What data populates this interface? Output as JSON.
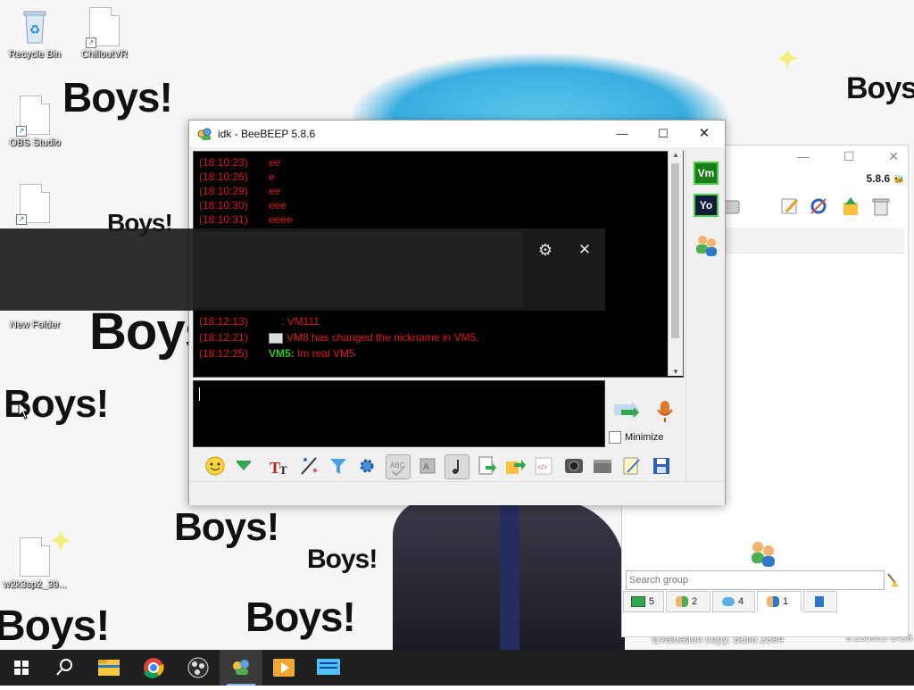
{
  "desktop": {
    "icons": [
      {
        "label": "Recycle Bin"
      },
      {
        "label": "ChilloutVR"
      },
      {
        "label": "OBS Studio"
      },
      {
        "label": "New Folder"
      },
      {
        "label": "w2k3sp2_39..."
      }
    ],
    "wallpaper_text": "Boys!",
    "watermark": "Evaluation copy. Build 2594",
    "watermark_right": "e.230901-1436"
  },
  "chat_window": {
    "title": "idk - BeeBEEP 5.8.6",
    "messages": [
      {
        "time": "(18:10:23)",
        "text": "ee"
      },
      {
        "time": "(18:10:26)",
        "text": "e"
      },
      {
        "time": "(18:10:29)",
        "text": "ee"
      },
      {
        "time": "(18:10:30)",
        "text": "eee"
      },
      {
        "time": "(18:10:31)",
        "text": "eeee"
      },
      {
        "time": "(18:12:13)",
        "text": ": VM111"
      },
      {
        "time": "(18:12:21)",
        "text": "VM8 has changed the nickname in VM5."
      },
      {
        "time": "(18:12:25)",
        "nick": "VM5:",
        "text": "Im real VM5"
      }
    ],
    "members": [
      {
        "badge": "Vm"
      },
      {
        "badge": "Yo"
      }
    ],
    "minimize_label": "Minimize",
    "input_value": ""
  },
  "main_window": {
    "version": "5.8.6",
    "search_placeholder": "Search group",
    "tabs": [
      {
        "count": "5"
      },
      {
        "count": "2"
      },
      {
        "count": "4"
      },
      {
        "count": "1"
      }
    ]
  },
  "colors": {
    "chat_bg": "#000000",
    "message_red": "#e01818",
    "nick_green": "#2fc72f",
    "accent_blue": "#8ab4f8"
  }
}
